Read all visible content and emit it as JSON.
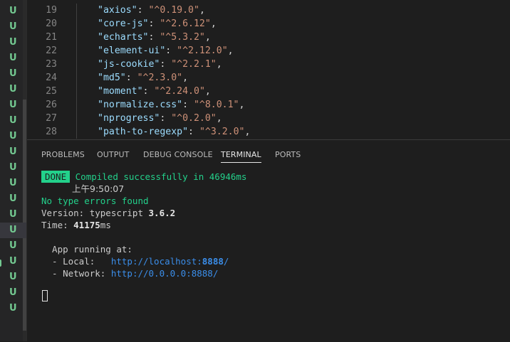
{
  "git_status": [
    "U",
    "U",
    "U",
    "U",
    "U",
    "U",
    "U",
    "U",
    "U",
    "U",
    "U",
    "U",
    "U",
    "U",
    "U",
    "U",
    "U",
    "U",
    "U",
    "U"
  ],
  "git_status_active_index": 14,
  "editor": {
    "lines": [
      {
        "num": "19",
        "key": "\"axios\"",
        "value": "\"^0.19.0\""
      },
      {
        "num": "20",
        "key": "\"core-js\"",
        "value": "\"^2.6.12\""
      },
      {
        "num": "21",
        "key": "\"echarts\"",
        "value": "\"^5.3.2\""
      },
      {
        "num": "22",
        "key": "\"element-ui\"",
        "value": "\"^2.12.0\""
      },
      {
        "num": "23",
        "key": "\"js-cookie\"",
        "value": "\"^2.2.1\""
      },
      {
        "num": "24",
        "key": "\"md5\"",
        "value": "\"^2.3.0\""
      },
      {
        "num": "25",
        "key": "\"moment\"",
        "value": "\"^2.24.0\""
      },
      {
        "num": "26",
        "key": "\"normalize.css\"",
        "value": "\"^8.0.1\""
      },
      {
        "num": "27",
        "key": "\"nprogress\"",
        "value": "\"^0.2.0\""
      },
      {
        "num": "28",
        "key": "\"path-to-regexp\"",
        "value": "\"^3.2.0\""
      }
    ]
  },
  "panel": {
    "tabs": [
      "PROBLEMS",
      "OUTPUT",
      "DEBUG CONSOLE",
      "TERMINAL",
      "PORTS"
    ],
    "active_tab": "TERMINAL"
  },
  "terminal": {
    "done_badge": "DONE",
    "compiled": "Compiled successfully in 46946ms",
    "time": "上午9:50:07",
    "no_errors": "No type errors found",
    "version_label": "Version: typescript ",
    "version_value": "3.6.2",
    "time_label": "Time: ",
    "time_value": "41175",
    "time_unit": "ms",
    "app_running": "  App running at:",
    "local_label": "  - Local:   ",
    "local_url_prefix": "http://localhost:",
    "local_url_port": "8888",
    "local_url_suffix": "/",
    "network_label": "  - Network: ",
    "network_url": "http://0.0.0.0:8888/"
  },
  "colors": {
    "git_untracked": "#73c991",
    "terminal_green": "#23d18b",
    "link": "#3b8eea",
    "string": "#ce9178",
    "key": "#9cdcfe"
  }
}
